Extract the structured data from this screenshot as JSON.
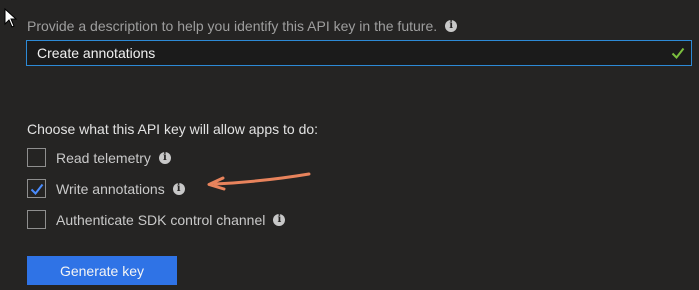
{
  "description": {
    "label": "Provide a description to help you identify this API key in the future.",
    "value": "Create annotations",
    "valid": true
  },
  "permissions": {
    "heading": "Choose what this API key will allow apps to do:",
    "options": [
      {
        "label": "Read telemetry",
        "checked": false
      },
      {
        "label": "Write annotations",
        "checked": true
      },
      {
        "label": "Authenticate SDK control channel",
        "checked": false
      }
    ]
  },
  "actions": {
    "generate_label": "Generate key"
  },
  "colors": {
    "background": "#252423",
    "input_border": "#2d8ad6",
    "checkmark": "#2f73e6",
    "valid_check": "#7bbf3e",
    "button": "#2f73e6",
    "arrow": "#e8835c"
  },
  "icons": {
    "info": "info-icon",
    "valid": "checkmark-icon",
    "pointer": "mouse-cursor-icon",
    "annotation": "arrow-annotation-icon"
  }
}
